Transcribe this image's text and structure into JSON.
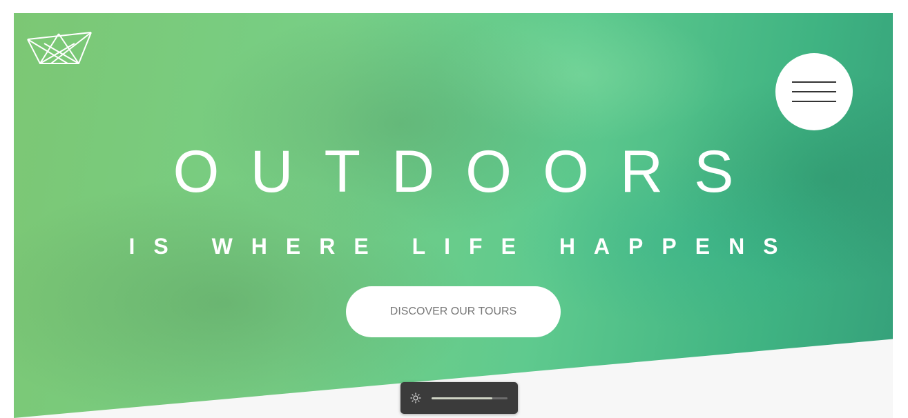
{
  "hero": {
    "title": "OUTDOORS",
    "subtitle": "IS WHERE LIFE HAPPENS",
    "cta_label": "DISCOVER OUR TOURS"
  },
  "header": {
    "logo_icon": "crown-icon",
    "menu_icon": "hamburger-menu-icon"
  },
  "brightness_widget": {
    "icon": "sun-icon",
    "level": 0.8
  },
  "colors": {
    "gradient_start": "#7cc774",
    "gradient_end": "#35a07a",
    "cta_text": "#777777",
    "widget_bg": "#3b3b3b"
  }
}
